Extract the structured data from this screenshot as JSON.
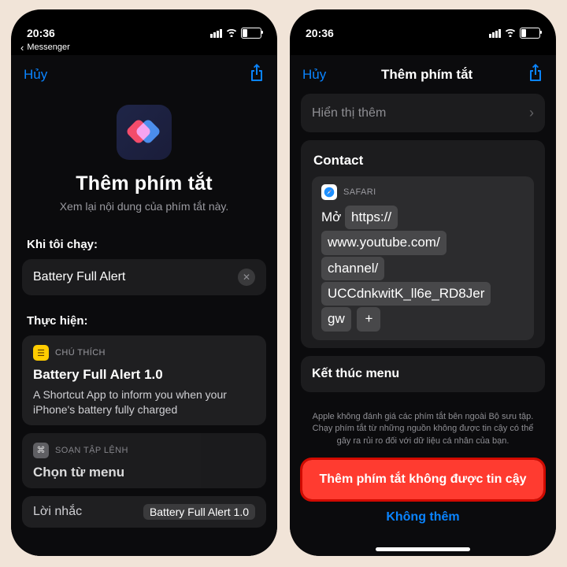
{
  "status": {
    "time": "20:36",
    "back_app": "Messenger"
  },
  "nav": {
    "cancel": "Hủy",
    "title": "Thêm phím tắt"
  },
  "left": {
    "heading": "Thêm phím tắt",
    "subheading": "Xem lại nội dung của phím tắt này.",
    "when_label": "Khi tôi chạy:",
    "shortcut_name": "Battery Full Alert",
    "perform_label": "Thực hiện:",
    "note": {
      "badge": "CHÚ THÍCH",
      "title": "Battery Full Alert 1.0",
      "body": "A Shortcut App to inform you when your iPhone's  battery fully charged"
    },
    "script": {
      "badge": "SOẠN TẬP LỆNH",
      "title": "Chọn từ menu"
    },
    "reminder": {
      "label": "Lời nhắc",
      "value": "Battery Full Alert  1.0"
    }
  },
  "right": {
    "show_more": "Hiển thị thêm",
    "contact": "Contact",
    "safari": {
      "badge": "SAFARI",
      "open": "Mở",
      "url_parts": [
        "https://",
        "www.youtube.com/",
        "channel/",
        "UCCdnkwitK_ll6e_RD8Jer",
        "gw"
      ],
      "plus": "+"
    },
    "end_menu": "Kết thúc menu",
    "disclaimer": "Apple không đánh giá các phím tắt bên ngoài Bộ sưu tập. Chạy phím tắt từ những nguồn không được tin cậy có thể gây ra rủi ro đối với dữ liệu cá nhân của bạn.",
    "danger": "Thêm phím tắt không được tin cậy",
    "skip": "Không thêm"
  }
}
